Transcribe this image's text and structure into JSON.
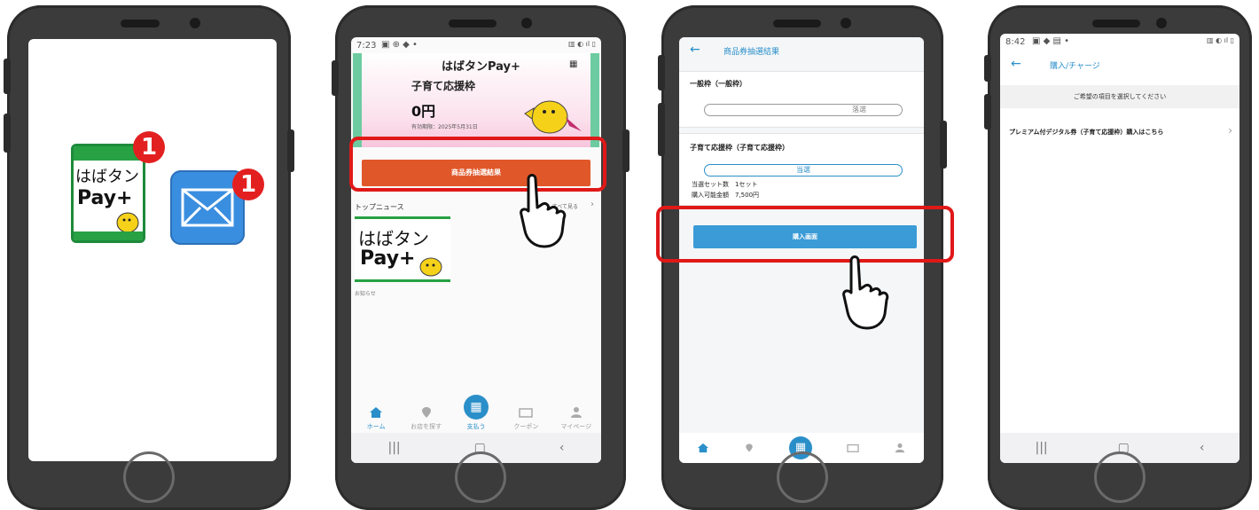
{
  "phone1": {
    "app_icon_text_1": "はばタン",
    "app_icon_text_2": "Pay+",
    "app_badge": "1",
    "mail_badge": "1"
  },
  "phone2": {
    "status_time": "7:23",
    "card": {
      "brand": "はばタンPay+",
      "frame": "子育て応援枠",
      "balance": "0円",
      "expiry": "有効期限：2025年5月31日"
    },
    "lottery_button": "商品券抽選結果",
    "news_title": "トップニュース",
    "news_more": "すべて見る",
    "news_banner_1": "はばタン",
    "news_banner_2": "Pay+",
    "news_caption": "お知らせ",
    "tabs": [
      "ホーム",
      "お店を探す",
      "支払う",
      "クーポン",
      "マイページ"
    ]
  },
  "phone3": {
    "header_title": "商品券抽選結果",
    "general_title": "一般枠（一般枠）",
    "general_result": "落選",
    "child_title": "子育て応援枠（子育て応援枠）",
    "child_result": "当選",
    "sets_label": "当選セット数　1セット",
    "amount_label": "購入可能金額　7,500円",
    "purchase_button": "購入画面"
  },
  "phone4": {
    "status_time": "8:42",
    "header_title": "購入/チャージ",
    "instruction": "ご希望の項目を選択してください",
    "option": "プレミアム付デジタル券（子育て応援枠）購入はこちら"
  },
  "colors": {
    "phone_body": "#3b3b3b",
    "highlight_red": "#e01818",
    "orange_button": "#e0582a",
    "blue_button": "#3a9bd6",
    "tab_active": "#2a8fc9",
    "header_blue": "#2a8fc9"
  }
}
